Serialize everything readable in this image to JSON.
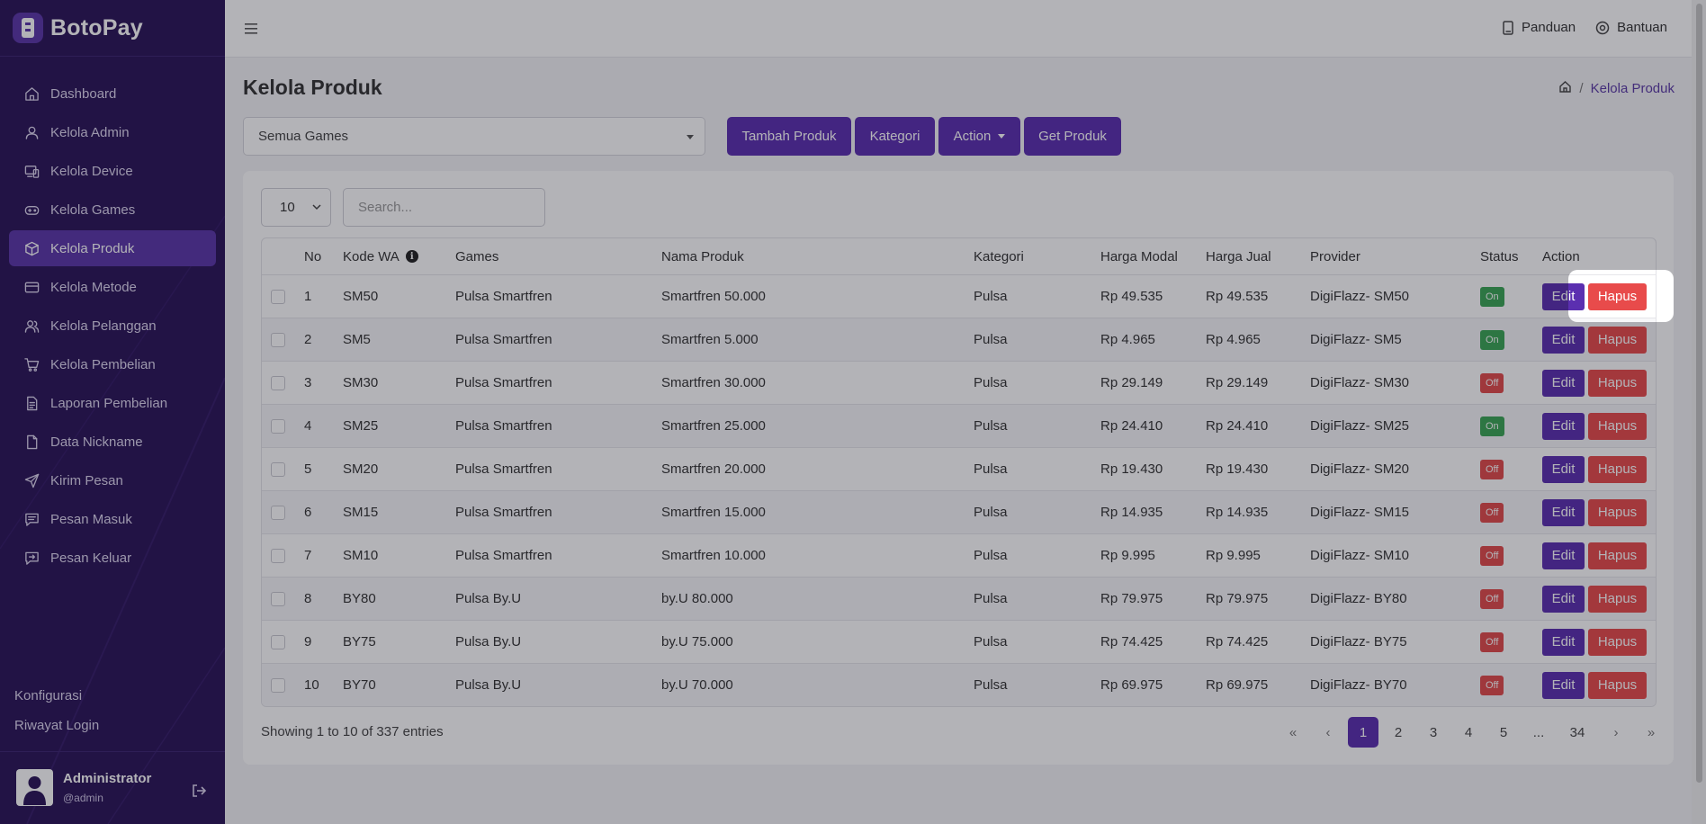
{
  "app": {
    "brand": "BotoPay"
  },
  "sidebar": {
    "items": [
      {
        "label": "Dashboard",
        "icon": "home-icon",
        "name": "sidebar-item-dashboard"
      },
      {
        "label": "Kelola Admin",
        "icon": "user-icon",
        "name": "sidebar-item-kelola-admin"
      },
      {
        "label": "Kelola Device",
        "icon": "devices-icon",
        "name": "sidebar-item-kelola-device"
      },
      {
        "label": "Kelola Games",
        "icon": "gamepad-icon",
        "name": "sidebar-item-kelola-games"
      },
      {
        "label": "Kelola Produk",
        "icon": "box-icon",
        "name": "sidebar-item-kelola-produk",
        "active": true
      },
      {
        "label": "Kelola Metode",
        "icon": "credit-card-icon",
        "name": "sidebar-item-kelola-metode"
      },
      {
        "label": "Kelola Pelanggan",
        "icon": "users-icon",
        "name": "sidebar-item-kelola-pelanggan"
      },
      {
        "label": "Kelola Pembelian",
        "icon": "cart-icon",
        "name": "sidebar-item-kelola-pembelian"
      },
      {
        "label": "Laporan Pembelian",
        "icon": "document-icon",
        "name": "sidebar-item-laporan-pembelian"
      },
      {
        "label": "Data Nickname",
        "icon": "file-icon",
        "name": "sidebar-item-data-nickname"
      },
      {
        "label": "Kirim Pesan",
        "icon": "send-icon",
        "name": "sidebar-item-kirim-pesan"
      },
      {
        "label": "Pesan Masuk",
        "icon": "message-icon",
        "name": "sidebar-item-pesan-masuk"
      },
      {
        "label": "Pesan Keluar",
        "icon": "message-out-icon",
        "name": "sidebar-item-pesan-keluar"
      }
    ],
    "bottom_links": [
      "Konfigurasi",
      "Riwayat Login"
    ],
    "user": {
      "name": "Administrator",
      "handle": "@admin"
    }
  },
  "topbar": {
    "links": [
      "Panduan",
      "Bantuan"
    ]
  },
  "page": {
    "title": "Kelola Produk",
    "breadcrumb_current": "Kelola Produk",
    "breadcrumb_sep": "/"
  },
  "filters": {
    "games_select": "Semua Games",
    "buttons": [
      "Tambah Produk",
      "Kategori",
      "Action",
      "Get Produk"
    ],
    "page_length": "10",
    "search_placeholder": "Search..."
  },
  "table": {
    "columns": [
      "No",
      "Kode WA",
      "Games",
      "Nama Produk",
      "Kategori",
      "Harga Modal",
      "Harga Jual",
      "Provider",
      "Status",
      "Action"
    ],
    "action_labels": {
      "edit": "Edit",
      "delete": "Hapus"
    },
    "rows": [
      {
        "no": "1",
        "kode": "SM50",
        "games": "Pulsa Smartfren",
        "nama": "Smartfren 50.000",
        "kategori": "Pulsa",
        "modal": "Rp 49.535",
        "jual": "Rp 49.535",
        "provider": "DigiFlazz- SM50",
        "status": "On"
      },
      {
        "no": "2",
        "kode": "SM5",
        "games": "Pulsa Smartfren",
        "nama": "Smartfren 5.000",
        "kategori": "Pulsa",
        "modal": "Rp 4.965",
        "jual": "Rp 4.965",
        "provider": "DigiFlazz- SM5",
        "status": "On"
      },
      {
        "no": "3",
        "kode": "SM30",
        "games": "Pulsa Smartfren",
        "nama": "Smartfren 30.000",
        "kategori": "Pulsa",
        "modal": "Rp 29.149",
        "jual": "Rp 29.149",
        "provider": "DigiFlazz- SM30",
        "status": "Off"
      },
      {
        "no": "4",
        "kode": "SM25",
        "games": "Pulsa Smartfren",
        "nama": "Smartfren 25.000",
        "kategori": "Pulsa",
        "modal": "Rp 24.410",
        "jual": "Rp 24.410",
        "provider": "DigiFlazz- SM25",
        "status": "On"
      },
      {
        "no": "5",
        "kode": "SM20",
        "games": "Pulsa Smartfren",
        "nama": "Smartfren 20.000",
        "kategori": "Pulsa",
        "modal": "Rp 19.430",
        "jual": "Rp 19.430",
        "provider": "DigiFlazz- SM20",
        "status": "Off"
      },
      {
        "no": "6",
        "kode": "SM15",
        "games": "Pulsa Smartfren",
        "nama": "Smartfren 15.000",
        "kategori": "Pulsa",
        "modal": "Rp 14.935",
        "jual": "Rp 14.935",
        "provider": "DigiFlazz- SM15",
        "status": "Off"
      },
      {
        "no": "7",
        "kode": "SM10",
        "games": "Pulsa Smartfren",
        "nama": "Smartfren 10.000",
        "kategori": "Pulsa",
        "modal": "Rp 9.995",
        "jual": "Rp 9.995",
        "provider": "DigiFlazz- SM10",
        "status": "Off"
      },
      {
        "no": "8",
        "kode": "BY80",
        "games": "Pulsa By.U",
        "nama": "by.U 80.000",
        "kategori": "Pulsa",
        "modal": "Rp 79.975",
        "jual": "Rp 79.975",
        "provider": "DigiFlazz- BY80",
        "status": "Off"
      },
      {
        "no": "9",
        "kode": "BY75",
        "games": "Pulsa By.U",
        "nama": "by.U 75.000",
        "kategori": "Pulsa",
        "modal": "Rp 74.425",
        "jual": "Rp 74.425",
        "provider": "DigiFlazz- BY75",
        "status": "Off"
      },
      {
        "no": "10",
        "kode": "BY70",
        "games": "Pulsa By.U",
        "nama": "by.U 70.000",
        "kategori": "Pulsa",
        "modal": "Rp 69.975",
        "jual": "Rp 69.975",
        "provider": "DigiFlazz- BY70",
        "status": "Off"
      }
    ]
  },
  "footer": {
    "showing": "Showing 1 to 10 of 337 entries",
    "pagination": [
      "«",
      "‹",
      "1",
      "2",
      "3",
      "4",
      "5",
      "...",
      "34",
      "›",
      "»"
    ],
    "current_page": "1"
  },
  "colors": {
    "sidebar_bg": "#2a1457",
    "primary": "#5b2fb0",
    "danger": "#e84b4b",
    "success": "#3aa655"
  }
}
